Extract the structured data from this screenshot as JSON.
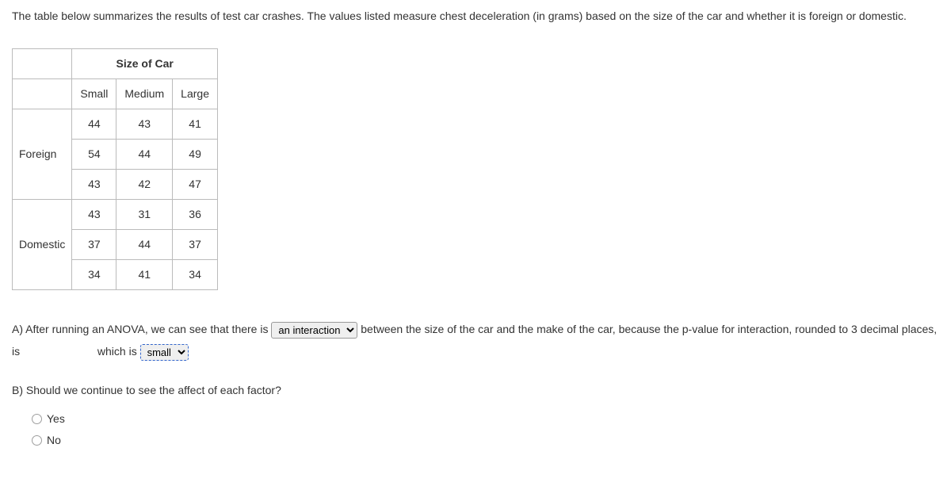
{
  "intro": "The table below summarizes the results of test car crashes. The values listed measure chest deceleration (in grams) based on the size of the car and whether it is foreign or domestic.",
  "table": {
    "colgroup_header": "Size of Car",
    "columns": [
      "Small",
      "Medium",
      "Large"
    ],
    "groups": [
      {
        "label": "Foreign",
        "rows": [
          [
            "44",
            "43",
            "41"
          ],
          [
            "54",
            "44",
            "49"
          ],
          [
            "43",
            "42",
            "47"
          ]
        ]
      },
      {
        "label": "Domestic",
        "rows": [
          [
            "43",
            "31",
            "36"
          ],
          [
            "37",
            "44",
            "37"
          ],
          [
            "34",
            "41",
            "34"
          ]
        ]
      }
    ]
  },
  "qa": {
    "prefix": "A) After running an ANOVA, we can see that there is",
    "select1": "an interaction",
    "mid1": "between the size of the car and the make of the car, because the p-value for interaction, rounded to 3 decimal places, is",
    "blank": "",
    "mid2": "which is",
    "select2": "small"
  },
  "qb": {
    "text": "B) Should we continue to see the affect of each factor?",
    "opt_yes": "Yes",
    "opt_no": "No"
  }
}
